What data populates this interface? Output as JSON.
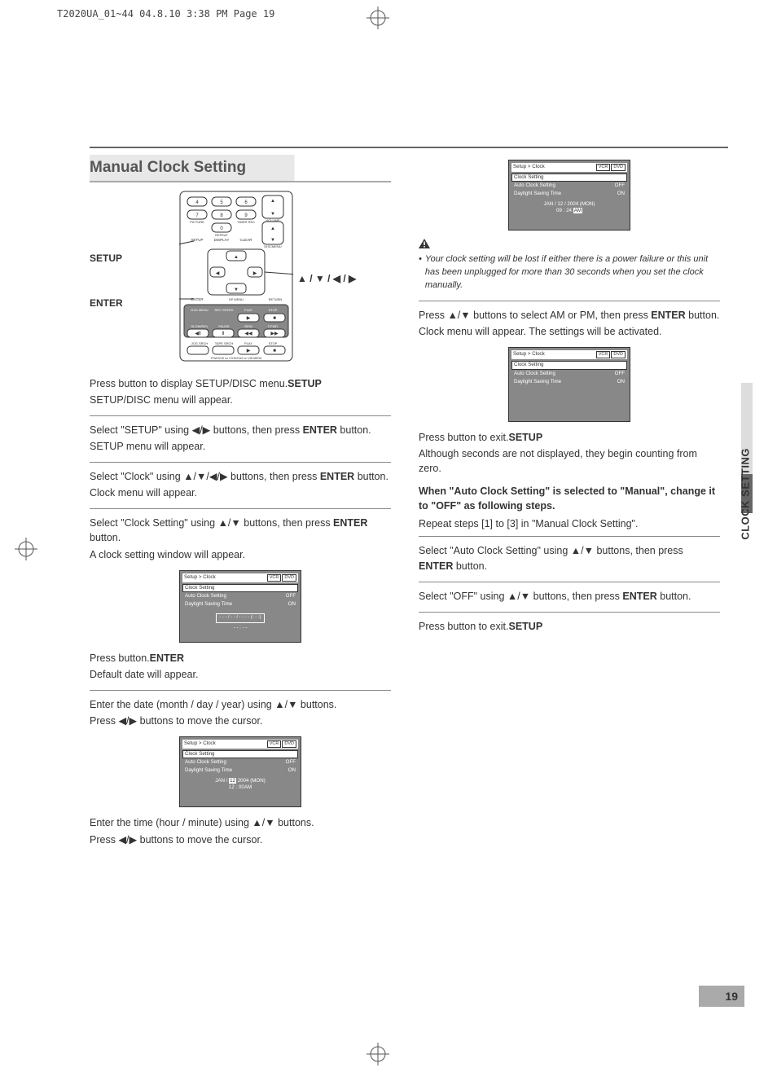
{
  "header": {
    "crop_info": "T2020UA_01~44  04.8.10 3:38 PM  Page 19"
  },
  "section_title": "Manual Clock Setting",
  "remote": {
    "label_setup": "SETUP",
    "label_enter": "ENTER",
    "label_arrows": "▲ / ▼ / ◀ / ▶",
    "btn_labels": {
      "picture": "PICTURE",
      "repeat": "REPEAT",
      "timer": "TIMER REC",
      "volume": "VOLUME",
      "setup": "SETUP",
      "display": "DISPLAY",
      "clear": "CLEAR",
      "discmenu": "DISCMENU",
      "enter": "ENTER",
      "spmenu": "SP MENU",
      "return": "RETURN",
      "dvdmenu": "DVD MENU",
      "recspeed": "REC SPEED",
      "play": "PLAY",
      "stop": "STOP",
      "slow": "SLOW/REV",
      "pause": "PAUSE",
      "rew": "REW",
      "ffwd": "F.FWD",
      "jog": "JOG SRCH",
      "tape": "TAPE SRCH",
      "play2": "PLAY",
      "stop2": "STOP",
      "footer": "POW:DVD on  CH:BOX#2 on  VID:MENU"
    }
  },
  "left": [
    {
      "lead": "Press ",
      "b": "SETUP",
      "tail": " button to display SETUP/DISC menu.",
      "line2": "SETUP/DISC menu will appear."
    },
    {
      "lead": "Select \"SETUP\" using ",
      "sym": "◀/▶",
      "tail": " buttons, then press ",
      "b": "ENTER",
      "tail2": " button.",
      "line2": "SETUP menu will appear."
    },
    {
      "lead": "Select \"Clock\" using ",
      "sym": "▲/▼/◀/▶",
      "tail": " buttons, then press ",
      "b": "ENTER",
      "tail2": " button.",
      "line2": "Clock menu will appear."
    },
    {
      "lead": "Select \"Clock Setting\" using ",
      "sym": "▲/▼",
      "tail": " buttons, then press ",
      "b": "ENTER",
      "tail2": " button.",
      "line2": "A clock setting window will appear."
    }
  ],
  "left_after_osd1": [
    {
      "lead": "Press ",
      "b": "ENTER",
      "tail": " button.",
      "line2": "Default date will appear."
    },
    {
      "lead": "Enter the date (month / day / year) using ",
      "sym": "▲/▼",
      "tail": " buttons.",
      "line2pre": "Press ",
      "line2sym": "◀/▶",
      "line2post": " buttons to move the cursor."
    }
  ],
  "left_after_osd2": [
    {
      "lead": "Enter the time (hour / minute) using ",
      "sym": "▲/▼",
      "tail": " buttons.",
      "line2pre": "Press ",
      "line2sym": "◀/▶",
      "line2post": " buttons to move the cursor."
    }
  ],
  "osd_shared": {
    "title": "Setup > Clock",
    "badges": [
      "VCR",
      "DVD"
    ],
    "rows": [
      {
        "label": "Clock Setting",
        "val": ""
      },
      {
        "label": "Auto Clock Setting",
        "val": "OFF"
      },
      {
        "label": "Daylight Saving Time",
        "val": "ON"
      }
    ]
  },
  "osd1_body": {
    "line1": "- - - / - - / - - - - (- - -)",
    "line2": "- - : - -"
  },
  "osd2_body": {
    "prefix": "JAN /",
    "hl": "12",
    "suffix": " 2004 (MON)",
    "line2": "12 : 00AM"
  },
  "right_osd_top_body": {
    "line1": "JAN / 12 / 2004 (MON)",
    "line2pre": "09 : 24 ",
    "line2hl": "AM"
  },
  "note_text": "Your clock setting will be lost if either there is a power failure or this unit has been unplugged for more than 30 seconds when you set the clock manually.",
  "right_steps_1": [
    {
      "lead": "Press ",
      "sym": "▲/▼",
      "tail": " buttons to select AM or PM, then press ",
      "b": "ENTER",
      "tail2": " button.",
      "line2": "Clock menu will appear. The settings will be activated."
    }
  ],
  "right_steps_2": [
    {
      "lead": "Press ",
      "b": "SETUP",
      "tail": " button to exit.",
      "line2": "Although seconds are not displayed, they begin counting from zero."
    }
  ],
  "sub_heading": "When \"Auto Clock Setting\" is selected to \"Manual\", change it to \"OFF\" as following steps.",
  "sub_lead": "Repeat steps [1] to [3] in \"Manual Clock Setting\".",
  "right_steps_3": [
    {
      "lead": "Select \"Auto Clock Setting\" using ",
      "sym": "▲/▼",
      "tail": " buttons, then press ",
      "b": "ENTER",
      "tail2": " button."
    },
    {
      "lead": "Select \"OFF\" using ",
      "sym": "▲/▼",
      "tail": " buttons, then press ",
      "b": "ENTER",
      "tail2": " button."
    },
    {
      "lead": "Press ",
      "b": "SETUP",
      "tail": " button to exit."
    }
  ],
  "side_tab": "CLOCK SETTING",
  "page_number": "19"
}
